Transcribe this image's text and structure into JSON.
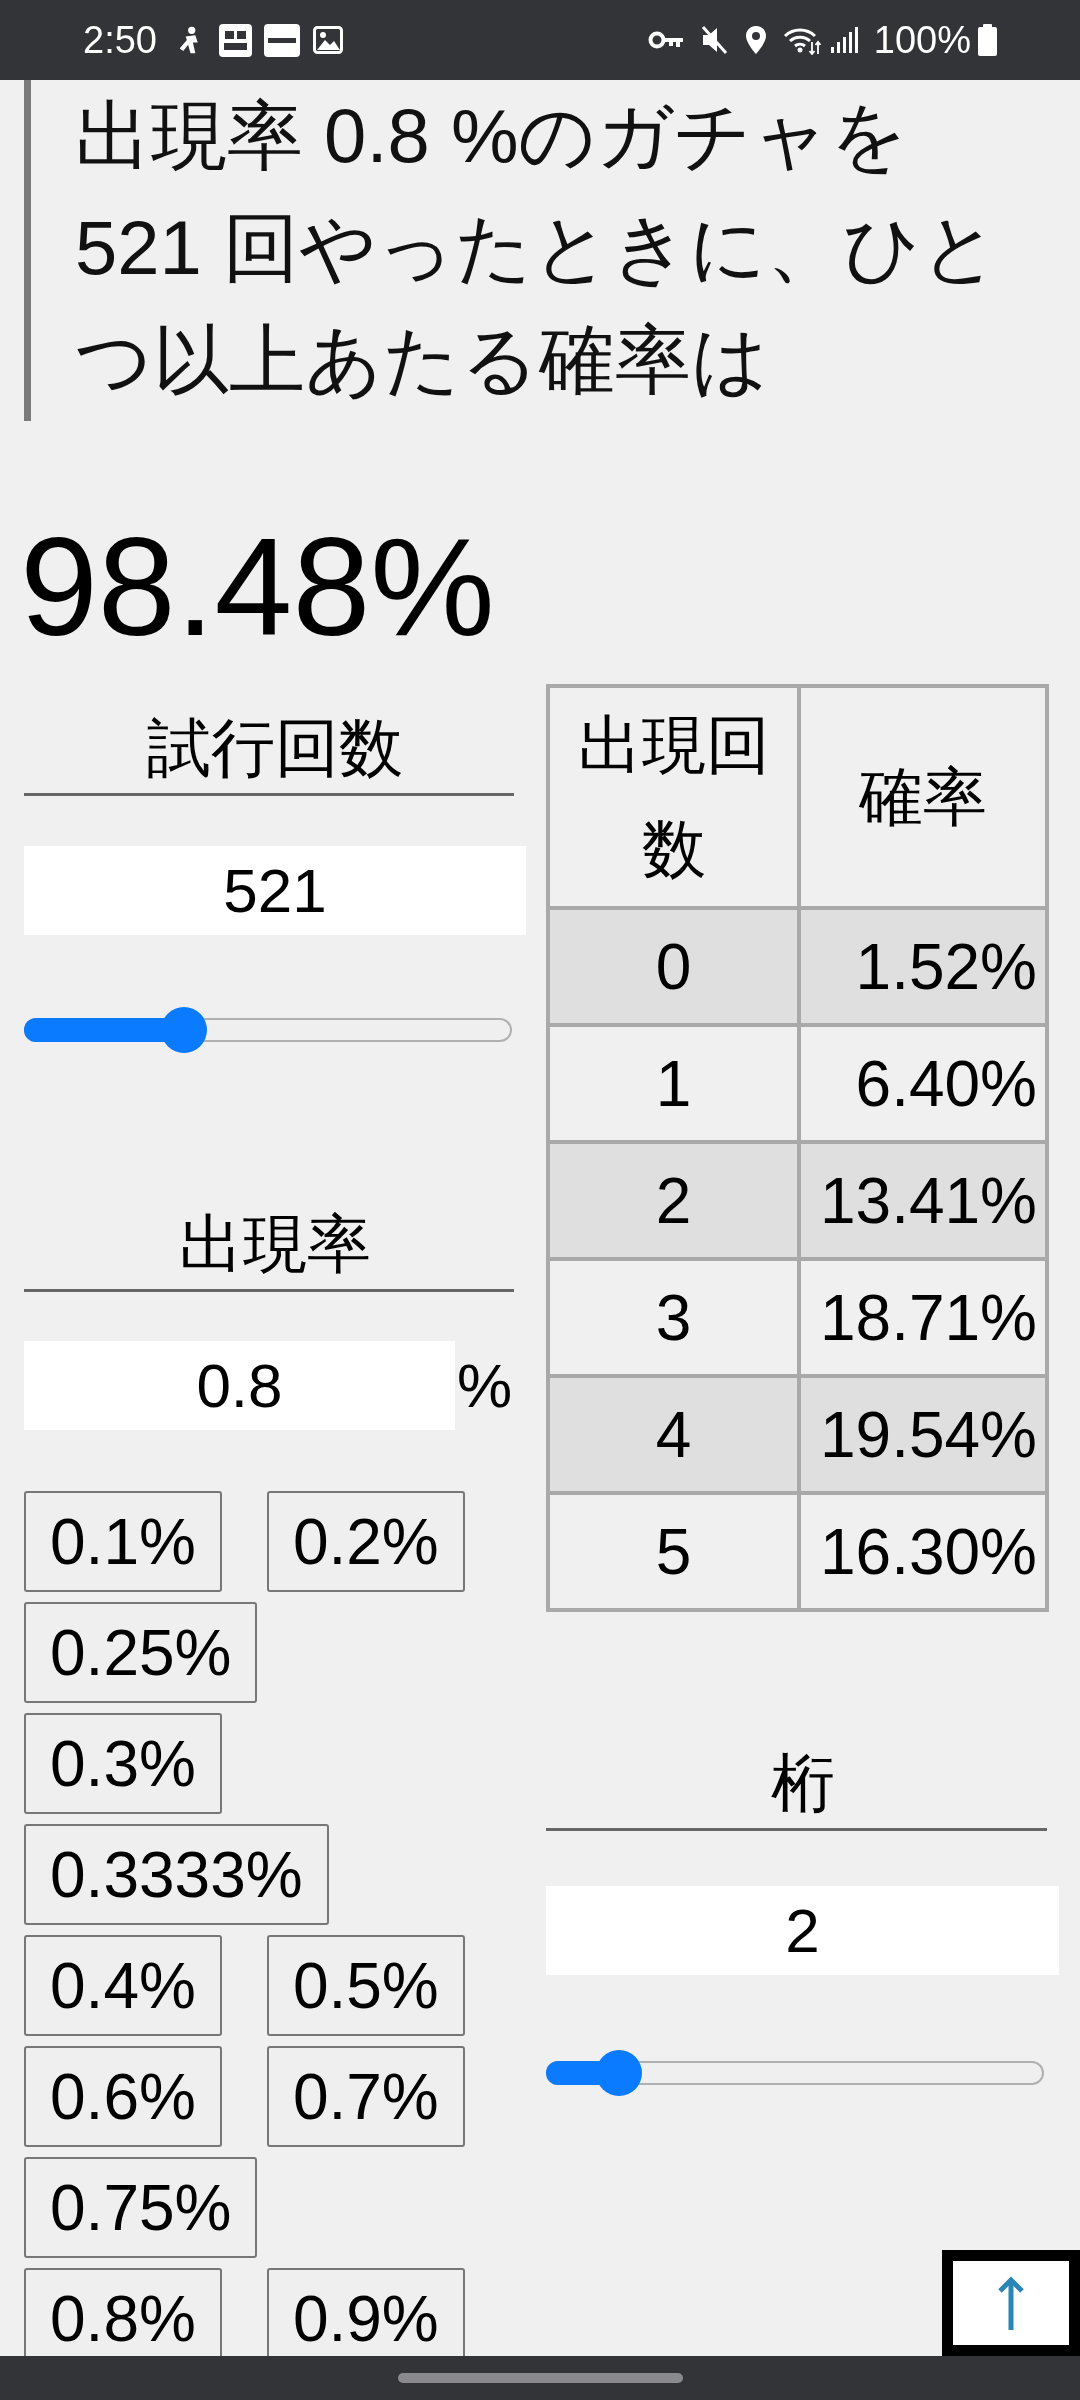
{
  "status_bar": {
    "time": "2:50",
    "battery": "100%"
  },
  "question": "出現率 0.8 %のガチャを521 回やったときに、ひとつ以上あたる確率は",
  "result": "98.48%",
  "trials": {
    "label": "試行回数",
    "value": "521",
    "level": 0.31
  },
  "rate": {
    "label": "出現率",
    "value": "0.8",
    "unit": "%",
    "presets": [
      "0.1%",
      "0.2%",
      "0.25%",
      "0.3%",
      "0.3333%",
      "0.4%",
      "0.5%",
      "0.6%",
      "0.7%",
      "0.75%",
      "0.8%",
      "0.9%"
    ]
  },
  "table": {
    "columns": [
      "出現回数",
      "確率"
    ],
    "rows": [
      {
        "count": "0",
        "probability": "1.52%"
      },
      {
        "count": "1",
        "probability": "6.40%"
      },
      {
        "count": "2",
        "probability": "13.41%"
      },
      {
        "count": "3",
        "probability": "18.71%"
      },
      {
        "count": "4",
        "probability": "19.54%"
      },
      {
        "count": "5",
        "probability": "16.30%"
      }
    ]
  },
  "digits": {
    "label": "桁",
    "value": "2",
    "level": 0.11
  }
}
